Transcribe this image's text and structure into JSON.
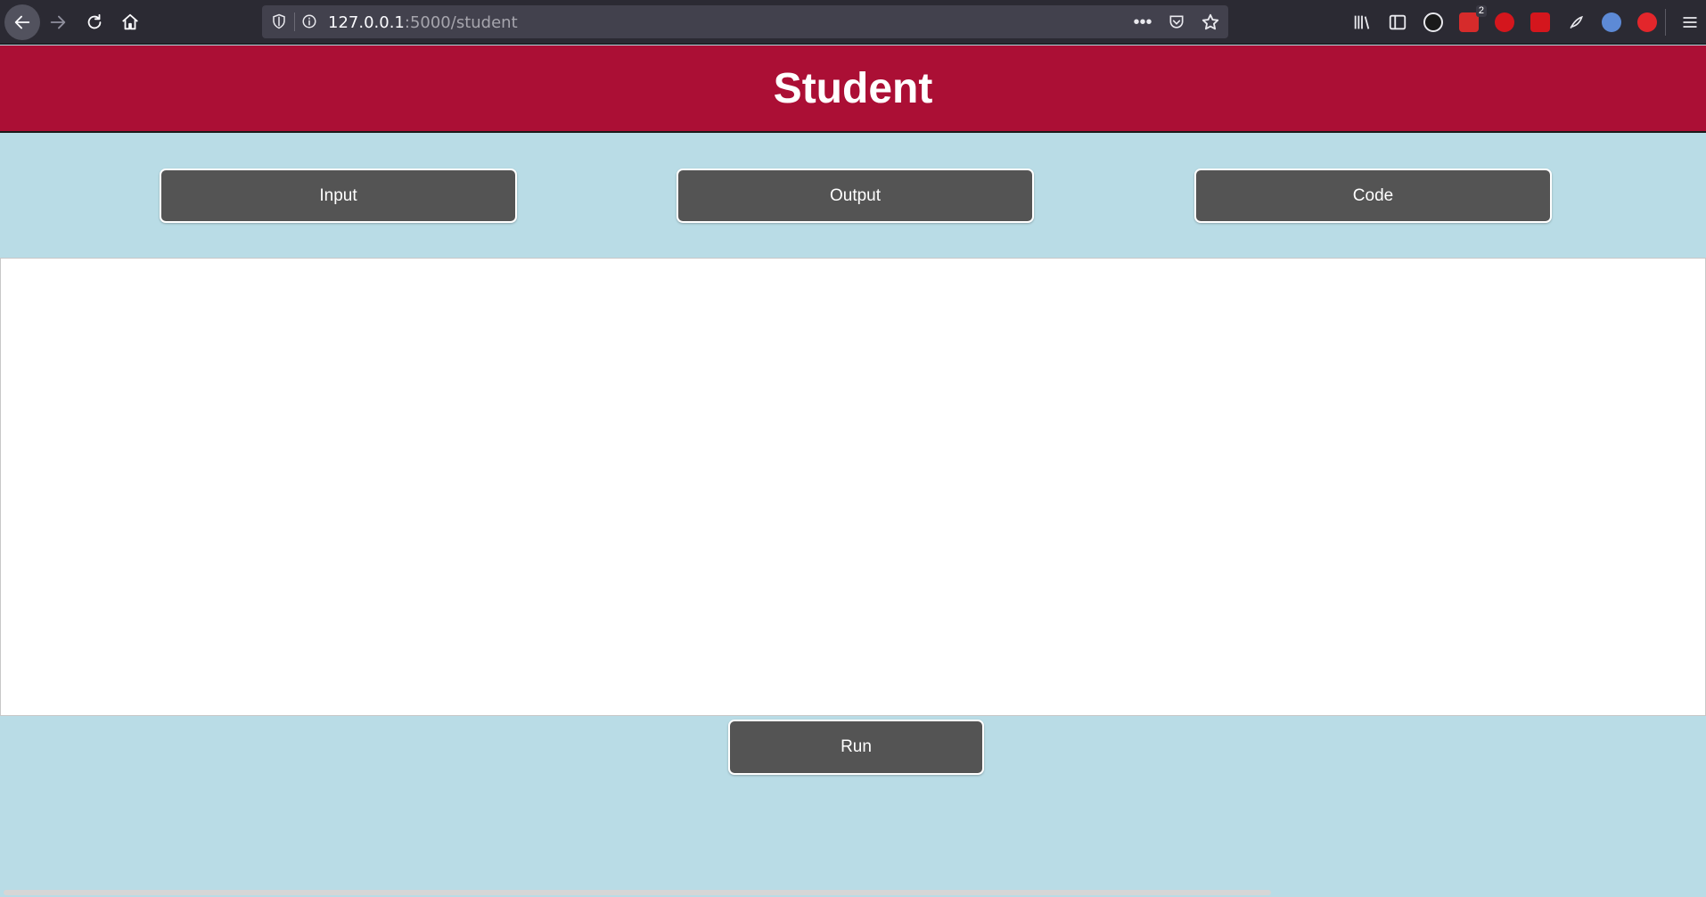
{
  "browser": {
    "url_host": "127.0.0.1",
    "url_path": ":5000/student",
    "extension_badge": "2",
    "icons": {
      "back": "arrow-left-icon",
      "forward": "arrow-right-icon",
      "reload": "reload-icon",
      "home": "home-icon",
      "shield": "shield-icon",
      "info": "info-icon",
      "more": "more-icon",
      "pocket": "pocket-icon",
      "bookmark": "star-icon",
      "library": "library-icon",
      "sidebar": "sidebar-icon",
      "menu": "hamburger-menu-icon"
    },
    "colors": {
      "chrome": "#2b2a33",
      "url_bar": "#42414d"
    }
  },
  "header": {
    "title": "Student",
    "color": "#ab0f35"
  },
  "tabs": [
    {
      "label": "Input"
    },
    {
      "label": "Output"
    },
    {
      "label": "Code"
    }
  ],
  "editor": {
    "value": ""
  },
  "actions": {
    "run_label": "Run"
  },
  "colors": {
    "background": "#b9dce6",
    "button": "#545454",
    "button_text": "#ffffff"
  }
}
